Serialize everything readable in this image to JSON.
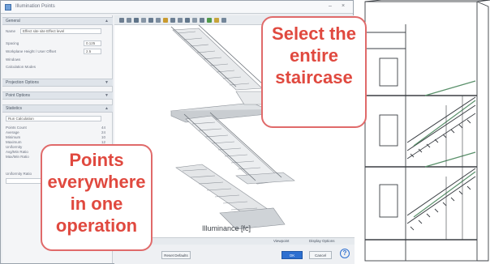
{
  "window": {
    "title": "Illumination Points",
    "help_symbol": "?",
    "min_symbol": "–",
    "close_symbol": "×"
  },
  "left_panel": {
    "sections": [
      {
        "label": "General",
        "chevron": "▲"
      },
      {
        "label": "Projection Options",
        "chevron": "▼"
      },
      {
        "label": "Point Options",
        "chevron": "▼"
      },
      {
        "label": "Statistics",
        "chevron": "▲"
      }
    ],
    "general": {
      "name_label": "Name",
      "name_value": "Effect site site Effect level",
      "spacing_label": "Spacing",
      "spacing_value": "0.125",
      "height_label": "Workplane Height / User Offset",
      "height_value": "2.5",
      "opt1": "Windows",
      "opt2": "Calculation Modes"
    },
    "statistics": {
      "field_value": "Run Calculation",
      "rows": [
        "Points Count",
        "Average",
        "Minimum",
        "Maximum",
        "Uniformity",
        "Avg/Min Ratio",
        "Max/Min Ratio"
      ],
      "values": [
        "44",
        "24",
        "10",
        "12",
        "9",
        "8",
        "1"
      ],
      "sub_label": "Uniformity Ratio"
    }
  },
  "viewport": {
    "label": "Illuminance [fc]",
    "bar_left": "Viewpoint",
    "bar_right": "Display Options"
  },
  "footer": {
    "reset_button": "Reset Defaults",
    "ok_button": "OK",
    "cancel_button": "Cancel"
  },
  "callouts": {
    "select": [
      "Select the",
      "entire",
      "staircase"
    ],
    "points": [
      "Points",
      "everywhere",
      "in one",
      "operation"
    ]
  },
  "colors": {
    "callout_text": "#e0493f",
    "callout_border": "#e06a6a",
    "primary_button": "#2d6fd0"
  }
}
